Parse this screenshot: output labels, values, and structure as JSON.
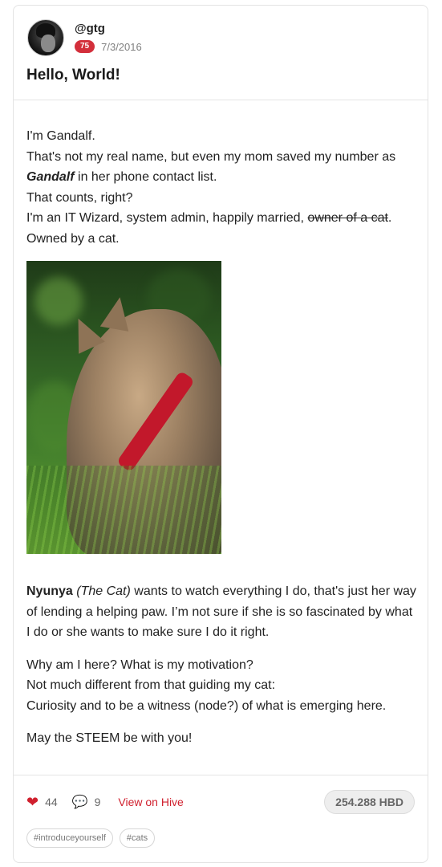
{
  "post": {
    "author": "@gtg",
    "reputation": "75",
    "date": "7/3/2016",
    "title": "Hello, World!"
  },
  "intro": {
    "line1": "I'm Gandalf.",
    "line2_a": "That's not my real name, but even my mom saved my number as ",
    "line2_bold": "Gandalf",
    "line2_b": " in her phone contact list.",
    "line3": "That counts, right?",
    "line4_a": "I'm an IT Wizard, system admin, happily married, ",
    "line4_strike": "owner of a cat",
    "line4_b": ".",
    "line5": "Owned by a cat."
  },
  "image": {
    "subject": "cat-photo"
  },
  "paragraph1": {
    "bold": "Nyunya",
    "italic": " (The Cat)",
    "rest": " wants to watch everything I do, that's just her way of lending a helping paw. I’m not sure if she is so fascinated by what I do or she wants to make sure I do it right."
  },
  "paragraph2": {
    "line1": "Why am I here? What is my motivation?",
    "line2": "Not much different from that guiding my cat:",
    "line3": "Curiosity and to be a witness (node?) of what is emerging here."
  },
  "paragraph3": "May the STEEM be with you!",
  "footer": {
    "likes": "44",
    "comments": "9",
    "view_on_hive": "View on Hive",
    "payout": "254.288 HBD",
    "tags": [
      "#introduceyourself",
      "#cats"
    ]
  },
  "colors": {
    "accent": "#d0202e",
    "reputation_badge": "#d32f3b"
  }
}
